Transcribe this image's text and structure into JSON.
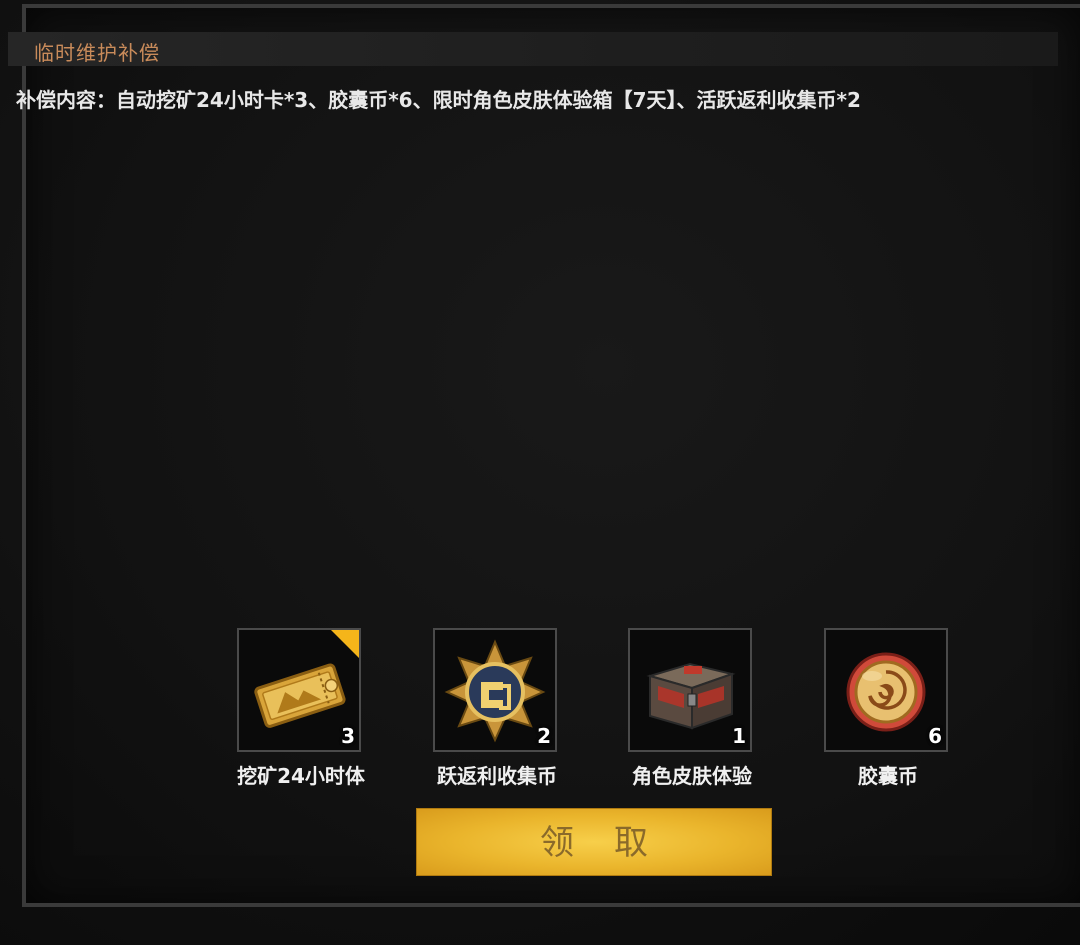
{
  "header": {
    "title": "临时维护补偿"
  },
  "content": {
    "text": "补偿内容：自动挖矿24小时卡*3、胶囊币*6、限时角色皮肤体验箱【7天】、活跃返利收集币*2"
  },
  "rewards": [
    {
      "name": "挖矿24小时体",
      "count": "3",
      "icon": "mining-ticket-icon",
      "badge": true
    },
    {
      "name": "跃返利收集币",
      "count": "2",
      "icon": "rebate-coin-icon",
      "badge": false
    },
    {
      "name": "角色皮肤体验",
      "count": "1",
      "icon": "skin-chest-icon",
      "badge": false
    },
    {
      "name": "胶囊币",
      "count": "6",
      "icon": "capsule-coin-icon",
      "badge": false
    }
  ],
  "claim_button": {
    "label": "领取"
  },
  "colors": {
    "title": "#c98b5a",
    "badge": "#f5b51a",
    "button": "#eab52c"
  }
}
